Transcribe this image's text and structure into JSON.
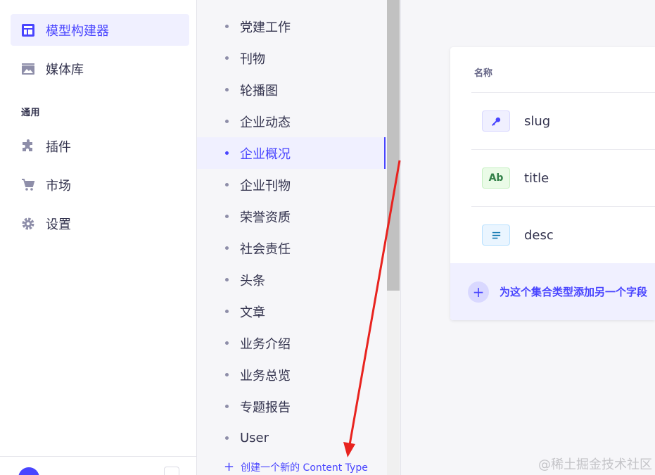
{
  "main_nav": {
    "items": [
      {
        "label": "模型构建器",
        "icon": "layout-icon",
        "active": true
      },
      {
        "label": "媒体库",
        "icon": "image-icon",
        "active": false
      }
    ],
    "section_title": "通用",
    "general_items": [
      {
        "label": "插件",
        "icon": "puzzle-icon"
      },
      {
        "label": "市场",
        "icon": "cart-icon"
      },
      {
        "label": "设置",
        "icon": "gear-icon"
      }
    ]
  },
  "sub_nav": {
    "items": [
      "党建工作",
      "刊物",
      "轮播图",
      "企业动态",
      "企业概况",
      "企业刊物",
      "荣誉资质",
      "社会责任",
      "头条",
      "文章",
      "业务介绍",
      "业务总览",
      "专题报告",
      "User"
    ],
    "active_item": "企业概况",
    "create_link": "创建一个新的 Content Type"
  },
  "fields_table": {
    "column_header": "名称",
    "rows": [
      {
        "badge": "",
        "badge_icon": "key-icon",
        "name": "slug"
      },
      {
        "badge": "Ab",
        "badge_icon": "text-icon",
        "name": "title"
      },
      {
        "badge": "",
        "badge_icon": "richtext-icon",
        "name": "desc"
      }
    ],
    "add_field_label": "为这个集合类型添加另一个字段"
  },
  "watermark": "@稀土掘金技术社区",
  "colors": {
    "primary": "#4945ff",
    "annotation_arrow": "#e8231f"
  }
}
